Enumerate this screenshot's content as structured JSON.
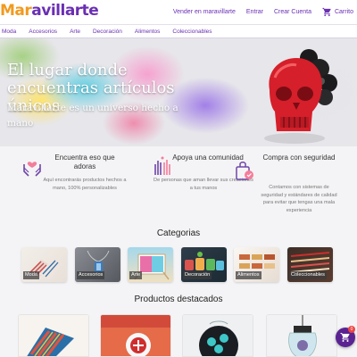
{
  "header": {
    "logo": {
      "part1": "Mar",
      "part2": "avillarte"
    },
    "links": [
      "Vender en maravillarte",
      "Entrar",
      "Crear Cuenta"
    ],
    "cart_label": "Carrito",
    "cart_count": "0"
  },
  "category_nav": [
    "Moda",
    "Accesorios",
    "Arte",
    "Decoración",
    "Alimentos",
    "Coleccionables"
  ],
  "hero": {
    "title": "El lugar donde encuentras artículos únicos",
    "subtitle": "Maravillarte es un universo hecho a mano"
  },
  "features": [
    {
      "title": "Encuentra eso que adoras",
      "desc": "Aquí encontrarás productos hechos a mano, 100% personalizables",
      "icon": "hands-heart-icon"
    },
    {
      "title": "Apoya una comunidad",
      "desc": "De personas que aman llevar sus creaciones a tus manos",
      "icon": "raised-hands-icon"
    },
    {
      "title": "Compra con seguridad",
      "desc": "Contamos con sistemas de seguridad y estándares de calidad para evitar que tengas una mala experiencia",
      "icon": "secure-bag-icon"
    }
  ],
  "categories_title": "Categorias",
  "categories": [
    "Moda",
    "Accesorios",
    "Arte",
    "Decoración",
    "Alimentos",
    "Coleccionables"
  ],
  "products_title": "Productos destacados",
  "colors": {
    "brand": "#6a2fb3",
    "logo_orange": "#f29a1e",
    "fab": "#5a2391"
  }
}
